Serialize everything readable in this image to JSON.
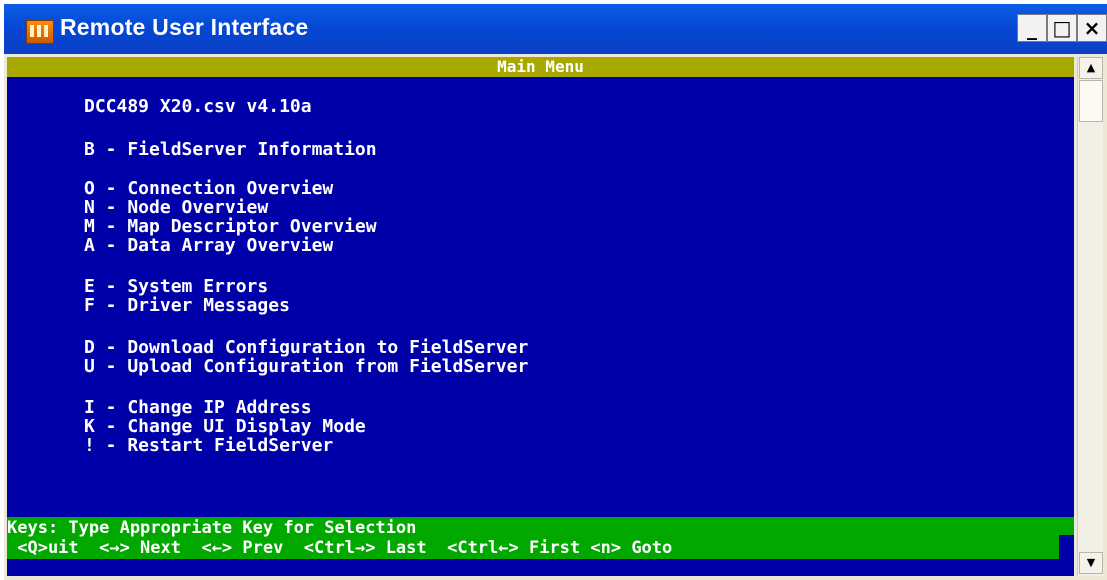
{
  "window": {
    "title": "Remote User Interface",
    "icon": "app-icon",
    "controls": {
      "minimize": "_",
      "maximize": "□",
      "close": "×"
    }
  },
  "terminal": {
    "header": "Main Menu",
    "version": "DCC489 X20.csv v4.10a",
    "menu": [
      {
        "key": "B",
        "text": "B - FieldServer Information"
      },
      {
        "key": "O",
        "text": "O - Connection Overview"
      },
      {
        "key": "N",
        "text": "N - Node Overview"
      },
      {
        "key": "M",
        "text": "M - Map Descriptor Overview"
      },
      {
        "key": "A",
        "text": "A - Data Array Overview"
      },
      {
        "key": "E",
        "text": "E - System Errors"
      },
      {
        "key": "F",
        "text": "F - Driver Messages"
      },
      {
        "key": "D",
        "text": "D - Download Configuration to FieldServer"
      },
      {
        "key": "U",
        "text": "U - Upload Configuration from FieldServer"
      },
      {
        "key": "I",
        "text": "I - Change IP Address"
      },
      {
        "key": "K",
        "text": "K - Change UI Display Mode"
      },
      {
        "key": "!",
        "text": "! - Restart FieldServer"
      }
    ],
    "status": {
      "line1": "Keys: Type Appropriate Key for Selection",
      "line2": " <Q>uit  <→> Next  <←> Prev  <Ctrl→> Last  <Ctrl←> First <n> Goto"
    }
  },
  "scrollbar": {
    "up": "▲",
    "down": "▼"
  },
  "colors": {
    "terminal_bg": "#0000a8",
    "header_bg": "#a8a800",
    "status_bg": "#00a800",
    "titlebar": "#0548d4"
  }
}
